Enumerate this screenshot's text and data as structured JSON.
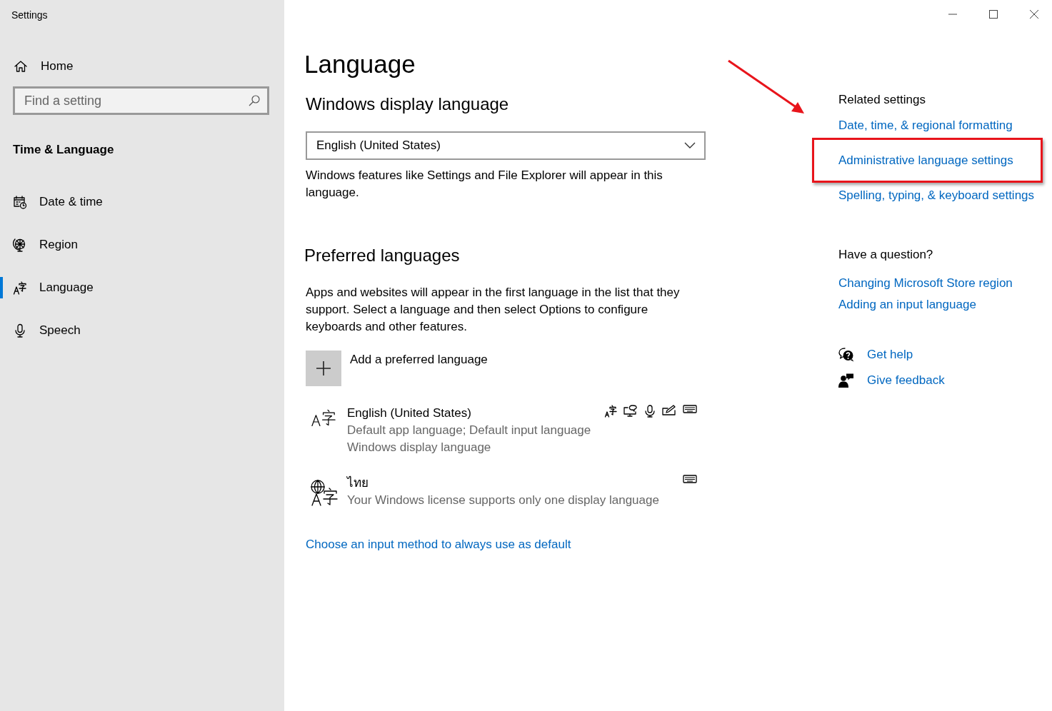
{
  "window": {
    "title": "Settings"
  },
  "sidebar": {
    "home": "Home",
    "search": {
      "placeholder": "Find a setting"
    },
    "section": "Time & Language",
    "items": [
      {
        "label": "Date & time",
        "selected": false
      },
      {
        "label": "Region",
        "selected": false
      },
      {
        "label": "Language",
        "selected": true
      },
      {
        "label": "Speech",
        "selected": false
      }
    ]
  },
  "main": {
    "title": "Language",
    "display_language": {
      "heading": "Windows display language",
      "dropdown": {
        "value": "English (United States)"
      },
      "description": "Windows features like Settings and File Explorer will appear in this language."
    },
    "preferred": {
      "heading": "Preferred languages",
      "description": "Apps and websites will appear in the first language in the list that they support. Select a language and then select Options to configure keyboards and other features.",
      "add_label": "Add a preferred language",
      "languages": [
        {
          "name": "English (United States)",
          "details": [
            "Default app language; Default input language",
            "Windows display language"
          ]
        },
        {
          "name": "ไทย",
          "details": [
            "Your Windows license supports only one display language"
          ]
        }
      ]
    },
    "input_method_link": "Choose an input method to always use as default"
  },
  "related": {
    "heading": "Related settings",
    "links": [
      {
        "label": "Date, time, & regional formatting",
        "highlighted": false
      },
      {
        "label": "Administrative language settings",
        "highlighted": true
      },
      {
        "label": "Spelling, typing, & keyboard settings",
        "highlighted": false
      }
    ]
  },
  "question": {
    "heading": "Have a question?",
    "links": [
      "Changing Microsoft Store region",
      "Adding an input language"
    ]
  },
  "help": [
    "Get help",
    "Give feedback"
  ]
}
